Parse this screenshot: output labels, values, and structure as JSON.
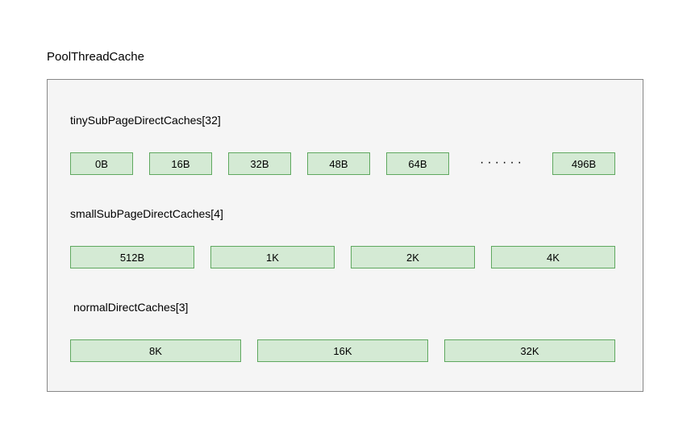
{
  "title": "PoolThreadCache",
  "sections": {
    "tiny": {
      "label": "tinySubPageDirectCaches[32]",
      "items": [
        "0B",
        "16B",
        "32B",
        "48B",
        "64B",
        "496B"
      ],
      "ellipsis": "······"
    },
    "small": {
      "label": "smallSubPageDirectCaches[4]",
      "items": [
        "512B",
        "1K",
        "2K",
        "4K"
      ]
    },
    "normal": {
      "label": "normalDirectCaches[3]",
      "items": [
        "8K",
        "16K",
        "32K"
      ]
    }
  }
}
